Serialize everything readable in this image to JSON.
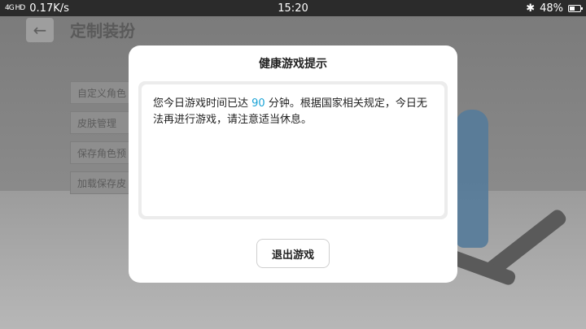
{
  "status_bar": {
    "signal_text": "4G HD",
    "net_speed": "0.17K/s",
    "time": "15:20",
    "bluetooth_icon": "bluetooth-icon",
    "battery_percent": "48%",
    "battery_level": 0.48
  },
  "background": {
    "back_icon": "back-arrow-icon",
    "title": "定制装扮",
    "menu": [
      "自定义角色",
      "皮肤管理",
      "保存角色预",
      "加载保存皮"
    ]
  },
  "dialog": {
    "title": "健康游戏提示",
    "message_prefix": "您今日游戏时间已达 ",
    "minutes": "90",
    "message_suffix": " 分钟。根据国家相关规定，今日无法再进行游戏，请注意适当休息。",
    "exit_label": "退出游戏",
    "highlight_color": "#19a3d6"
  }
}
